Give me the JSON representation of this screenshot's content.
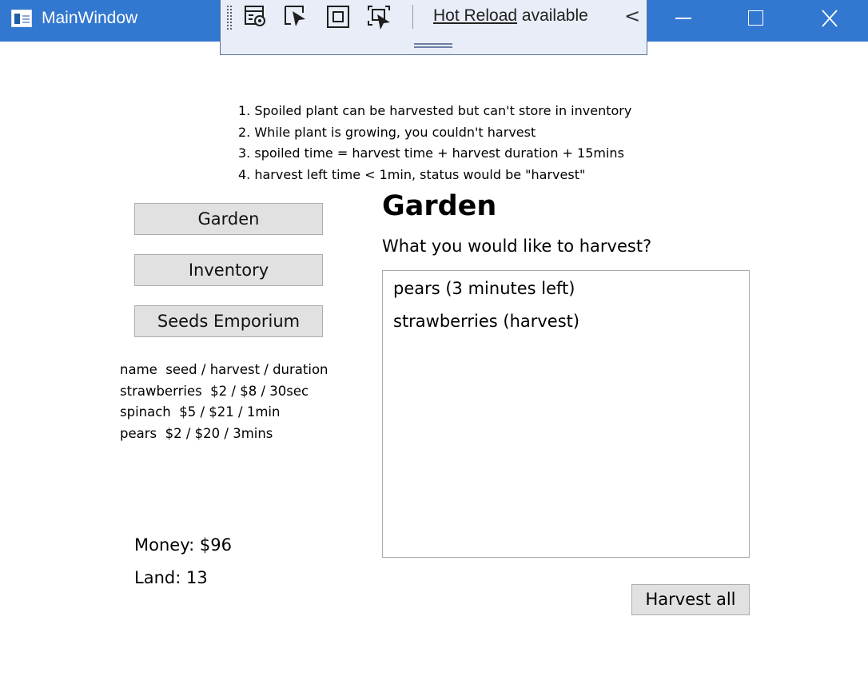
{
  "window": {
    "title": "MainWindow",
    "app_icon": "window-app-icon",
    "controls": {
      "minimize": "minimize-icon",
      "maximize": "maximize-icon",
      "close": "close-icon"
    }
  },
  "devtools_bar": {
    "tools": [
      "live-visual-tree-icon",
      "select-element-icon",
      "display-layout-adorners-icon",
      "track-focused-element-icon"
    ],
    "hot_reload_link": "Hot Reload",
    "hot_reload_suffix": " available",
    "collapse_glyph": "<"
  },
  "notes": [
    "1. Spoiled plant can be harvested but can't store in inventory",
    "2. While plant is growing, you couldn't harvest",
    "3. spoiled time = harvest time + harvest duration + 15mins",
    "4. harvest left time < 1min, status would be \"harvest\""
  ],
  "nav": {
    "garden": "Garden",
    "inventory": "Inventory",
    "seeds": "Seeds Emporium"
  },
  "price_list": [
    "name  seed / harvest / duration",
    "strawberries  $2 / $8 / 30sec",
    "spinach  $5 / $21 / 1min",
    "pears  $2 / $20 / 3mins"
  ],
  "status": {
    "money": "Money: $96",
    "land": "Land: 13"
  },
  "main": {
    "heading": "Garden",
    "prompt": "What you would like to harvest?",
    "items": [
      "pears (3 minutes left)",
      "strawberries (harvest)"
    ],
    "harvest_all": "Harvest all"
  },
  "colors": {
    "titlebar": "#3378d0",
    "devbar": "#e8edf8",
    "button_face": "#e1e1e1"
  }
}
